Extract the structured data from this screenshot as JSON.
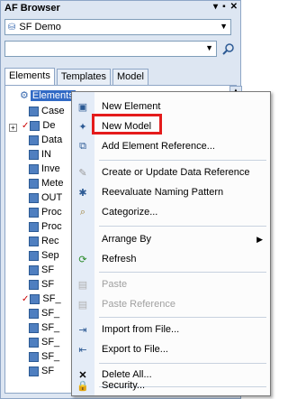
{
  "window": {
    "title": "AF Browser"
  },
  "database_selector": {
    "value": "SF Demo",
    "icon": "database-icon"
  },
  "search": {
    "value": "",
    "icon": "search-icon"
  },
  "tabs": [
    {
      "label": "Elements",
      "active": true
    },
    {
      "label": "Templates",
      "active": false
    },
    {
      "label": "Model",
      "active": false
    }
  ],
  "tree": {
    "root_label": "Elements",
    "nodes": [
      {
        "label": "Case",
        "checked": false
      },
      {
        "label": "De",
        "checked": true
      },
      {
        "label": "Data",
        "checked": false
      },
      {
        "label": "IN",
        "checked": false
      },
      {
        "label": "Inve",
        "checked": false
      },
      {
        "label": "Mete",
        "checked": false
      },
      {
        "label": "OUT",
        "checked": false
      },
      {
        "label": "Proc",
        "checked": false
      },
      {
        "label": "Proc",
        "checked": false
      },
      {
        "label": "Rec",
        "checked": false
      },
      {
        "label": "Sep",
        "checked": false
      },
      {
        "label": "SF",
        "checked": false
      },
      {
        "label": "SF",
        "checked": false
      },
      {
        "label": "SF_",
        "checked": true
      },
      {
        "label": "SF_",
        "checked": false
      },
      {
        "label": "SF_",
        "checked": false
      },
      {
        "label": "SF_",
        "checked": false
      },
      {
        "label": "SF_",
        "checked": false
      },
      {
        "label": "SF",
        "checked": false
      }
    ]
  },
  "context_menu": {
    "items": [
      {
        "label": "New Element",
        "icon": "new-element-icon",
        "disabled": false
      },
      {
        "label": "New Model",
        "icon": "new-model-icon",
        "disabled": false,
        "highlighted": true
      },
      {
        "label": "Add Element Reference...",
        "icon": "add-reference-icon",
        "disabled": false
      },
      {
        "label": "Create or Update Data Reference",
        "icon": "data-reference-icon",
        "disabled": false
      },
      {
        "label": "Reevaluate Naming Pattern",
        "icon": "naming-pattern-icon",
        "disabled": false
      },
      {
        "label": "Categorize...",
        "icon": "categorize-icon",
        "disabled": false
      },
      {
        "label": "Arrange By",
        "icon": "",
        "disabled": false,
        "submenu": true
      },
      {
        "label": "Refresh",
        "icon": "refresh-icon",
        "disabled": false
      },
      {
        "label": "Paste",
        "icon": "paste-icon",
        "disabled": true
      },
      {
        "label": "Paste Reference",
        "icon": "paste-reference-icon",
        "disabled": true
      },
      {
        "label": "Import from File...",
        "icon": "import-icon",
        "disabled": false
      },
      {
        "label": "Export to File...",
        "icon": "export-icon",
        "disabled": false
      },
      {
        "label": "Delete All...",
        "icon": "delete-icon",
        "disabled": false
      },
      {
        "label": "Security...",
        "icon": "security-icon",
        "disabled": false
      }
    ]
  },
  "colors": {
    "selection": "#316ac5",
    "highlight_box": "#e41b1b",
    "panel_bg": "#dde6f2"
  }
}
